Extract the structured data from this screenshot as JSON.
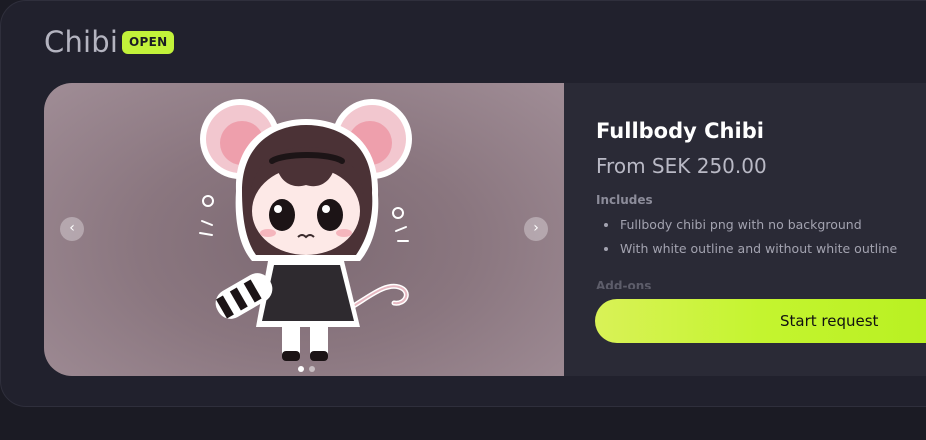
{
  "section": {
    "title": "Chibi",
    "status": "OPEN"
  },
  "carousel": {
    "prev_label": "‹",
    "next_label": "›",
    "slide_count": 2,
    "active_index": 0,
    "image_subject": "chibi-mouse-girl-illustration"
  },
  "product": {
    "name": "Fullbody Chibi",
    "price": "From SEK 250.00",
    "includes_title": "Includes",
    "includes": [
      "Fullbody chibi png with no background",
      "With white outline and without white outline"
    ],
    "addons_title": "Add-ons"
  },
  "actions": {
    "start_label": "Start request"
  },
  "colors": {
    "accent": "#c2f23a",
    "background": "#1b1b24",
    "card": "#21212d",
    "panel": "#2a2a36"
  }
}
